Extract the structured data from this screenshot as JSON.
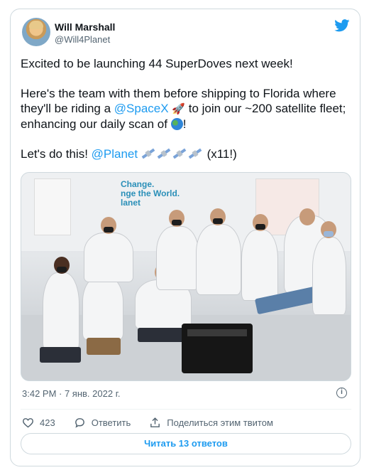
{
  "author": {
    "name": "Will Marshall",
    "handle": "@Will4Planet"
  },
  "tweet": {
    "line1": "Excited to be launching 44 SuperDoves next week!",
    "p2_a": "Here's the team with them before shipping to Florida where they'll be riding a ",
    "mention_spacex": "@SpaceX",
    "p2_b": " to join our ~200 satellite fleet; enhancing our daily scan of ",
    "p2_c": "!",
    "p3_a": "Let's do this! ",
    "mention_planet": "@Planet",
    "p3_b": " (x11!)"
  },
  "photo": {
    "sign_line1": "Change.",
    "sign_line2": "nge the World.",
    "sign_line3": "lanet"
  },
  "timestamp": "3:42 PM · 7 янв. 2022 г.",
  "actions": {
    "likes_count": "423",
    "reply_label": "Ответить",
    "share_label": "Поделиться этим твитом"
  },
  "replies_button": "Читать 13 ответов",
  "colors": {
    "accent": "#1d9bf0",
    "text": "#0f1419",
    "secondary": "#536471",
    "border": "#cfd9de"
  },
  "icons": [
    "twitter-bird-icon",
    "rocket-icon",
    "globe-icon",
    "satellite-icon",
    "heart-icon",
    "reply-bubble-icon",
    "share-icon",
    "info-icon"
  ]
}
